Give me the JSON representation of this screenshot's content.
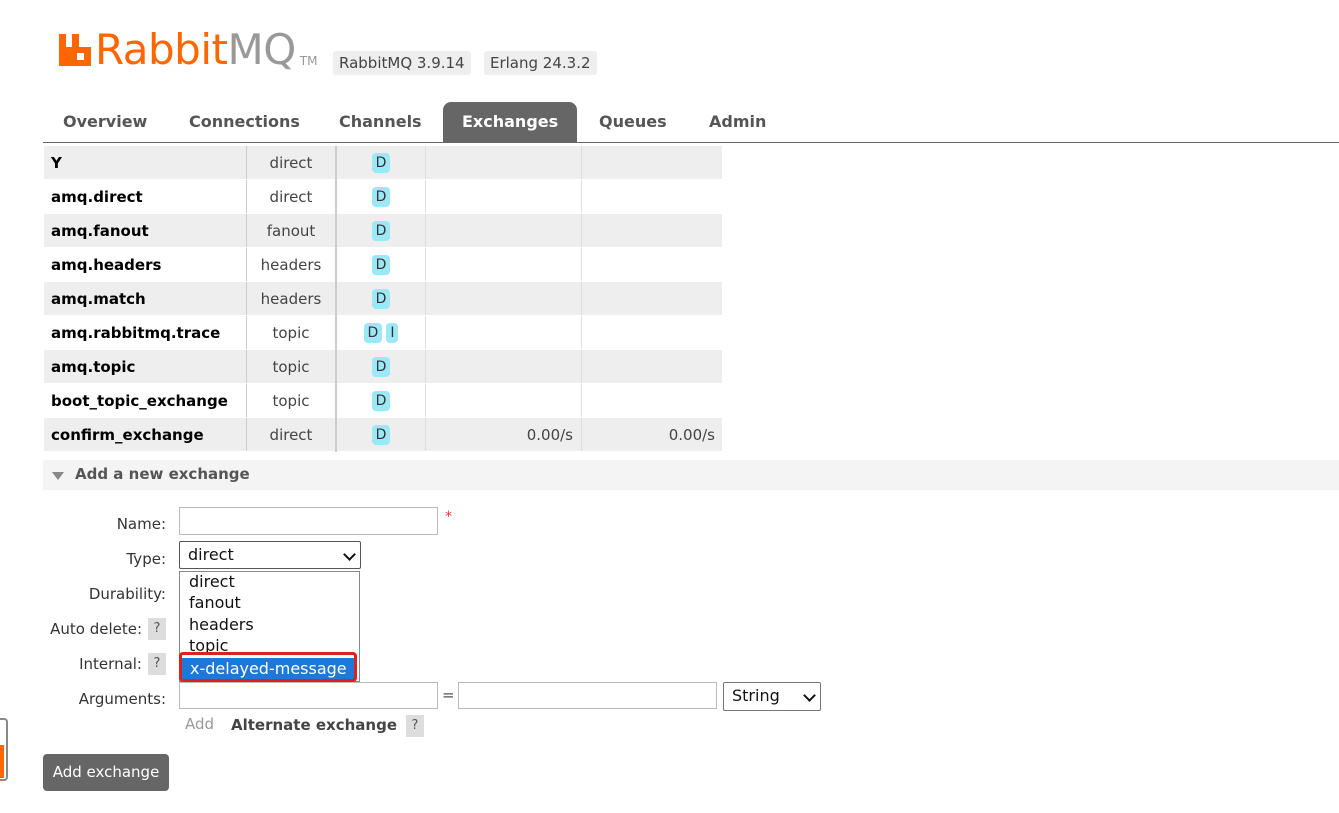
{
  "header": {
    "logo_rabbit": "Rabbit",
    "logo_mq": "MQ",
    "logo_tm": "TM",
    "rabbitmq_version": "RabbitMQ 3.9.14",
    "erlang_version": "Erlang 24.3.2"
  },
  "nav": {
    "tabs": [
      {
        "label": "Overview"
      },
      {
        "label": "Connections"
      },
      {
        "label": "Channels"
      },
      {
        "label": "Exchanges",
        "active": true
      },
      {
        "label": "Queues"
      },
      {
        "label": "Admin"
      }
    ]
  },
  "exchanges": {
    "rows": [
      {
        "name": "Y",
        "type": "direct",
        "features": [
          "D"
        ],
        "rate_in": "",
        "rate_out": ""
      },
      {
        "name": "amq.direct",
        "type": "direct",
        "features": [
          "D"
        ],
        "rate_in": "",
        "rate_out": ""
      },
      {
        "name": "amq.fanout",
        "type": "fanout",
        "features": [
          "D"
        ],
        "rate_in": "",
        "rate_out": ""
      },
      {
        "name": "amq.headers",
        "type": "headers",
        "features": [
          "D"
        ],
        "rate_in": "",
        "rate_out": ""
      },
      {
        "name": "amq.match",
        "type": "headers",
        "features": [
          "D"
        ],
        "rate_in": "",
        "rate_out": ""
      },
      {
        "name": "amq.rabbitmq.trace",
        "type": "topic",
        "features": [
          "D",
          "I"
        ],
        "rate_in": "",
        "rate_out": ""
      },
      {
        "name": "amq.topic",
        "type": "topic",
        "features": [
          "D"
        ],
        "rate_in": "",
        "rate_out": ""
      },
      {
        "name": "boot_topic_exchange",
        "type": "topic",
        "features": [
          "D"
        ],
        "rate_in": "",
        "rate_out": ""
      },
      {
        "name": "confirm_exchange",
        "type": "direct",
        "features": [
          "D"
        ],
        "rate_in": "0.00/s",
        "rate_out": "0.00/s"
      }
    ]
  },
  "add_exchange": {
    "section_title": "Add a new exchange",
    "name_label": "Name:",
    "name_value": "",
    "required_mark": "*",
    "type_label": "Type:",
    "type_selected": "direct",
    "type_options": [
      "direct",
      "fanout",
      "headers",
      "topic",
      "x-delayed-message"
    ],
    "type_highlighted": "x-delayed-message",
    "durability_label": "Durability:",
    "auto_delete_label": "Auto delete:",
    "internal_label": "Internal:",
    "help_mark": "?",
    "arguments_label": "Arguments:",
    "arg_key": "",
    "arg_equals": "=",
    "arg_value": "",
    "arg_type_selected": "String",
    "add_link": "Add",
    "alternate_exchange": "Alternate exchange",
    "submit_label": "Add exchange"
  },
  "colors": {
    "brand_orange": "#ff6600",
    "nav_active": "#666666",
    "feature_badge": "#9de8f7",
    "highlight_red": "#e02020",
    "option_selected": "#1e78d6"
  }
}
